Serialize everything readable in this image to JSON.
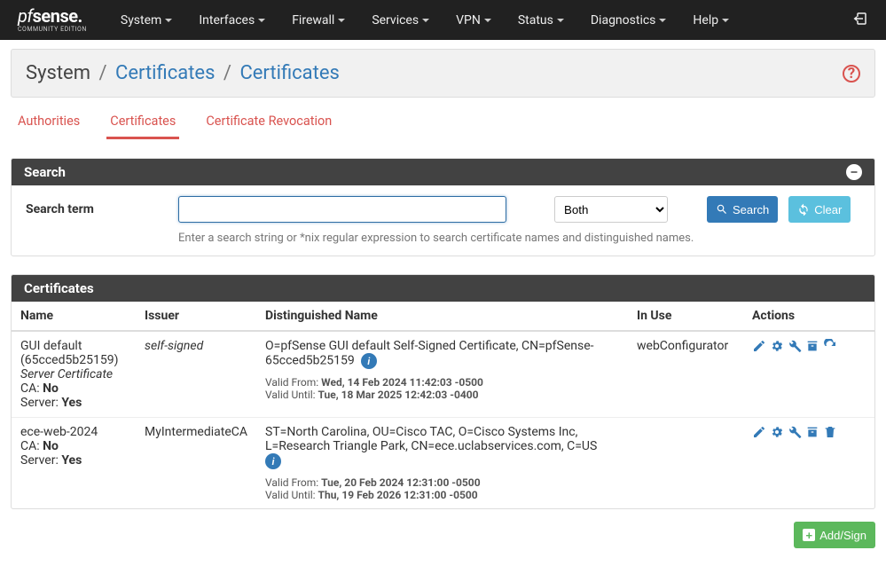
{
  "brand": {
    "top_pf": "pf",
    "top_sense": "sense",
    "top_dot": ".",
    "bottom": "COMMUNITY EDITION"
  },
  "nav": [
    "System",
    "Interfaces",
    "Firewall",
    "Services",
    "VPN",
    "Status",
    "Diagnostics",
    "Help"
  ],
  "breadcrumb": {
    "a": "System",
    "b": "Certificates",
    "c": "Certificates"
  },
  "tabs": [
    "Authorities",
    "Certificates",
    "Certificate Revocation"
  ],
  "active_tab": 1,
  "search_panel": {
    "title": "Search",
    "label": "Search term",
    "select_value": "Both",
    "search_btn": "Search",
    "clear_btn": "Clear",
    "help": "Enter a search string or *nix regular expression to search certificate names and distinguished names."
  },
  "table": {
    "title": "Certificates",
    "headers": [
      "Name",
      "Issuer",
      "Distinguished Name",
      "In Use",
      "Actions"
    ],
    "rows": [
      {
        "name": "GUI default (65cced5b25159)",
        "name_sub": "Server Certificate",
        "ca": "No",
        "server": "Yes",
        "issuer": "self-signed",
        "issuer_italic": true,
        "dn": "O=pfSense GUI default Self-Signed Certificate, CN=pfSense-65cced5b25159",
        "valid_from_lbl": "Valid From:",
        "valid_from": "Wed, 14 Feb 2024 11:42:03 -0500",
        "valid_until_lbl": "Valid Until:",
        "valid_until": "Tue, 18 Mar 2025 12:42:03 -0400",
        "in_use": "webConfigurator",
        "action_icons": [
          "pencil",
          "gear",
          "wrench",
          "archive",
          "refresh"
        ]
      },
      {
        "name": "ece-web-2024",
        "name_sub": "",
        "ca": "No",
        "server": "Yes",
        "issuer": "MyIntermediateCA",
        "issuer_italic": false,
        "dn": "ST=North Carolina, OU=Cisco TAC, O=Cisco Systems Inc, L=Research Triangle Park, CN=ece.uclabservices.com, C=US",
        "valid_from_lbl": "Valid From:",
        "valid_from": "Tue, 20 Feb 2024 12:31:00 -0500",
        "valid_until_lbl": "Valid Until:",
        "valid_until": "Thu, 19 Feb 2026 12:31:00 -0500",
        "in_use": "",
        "action_icons": [
          "pencil",
          "gear",
          "wrench",
          "archive",
          "trash"
        ]
      }
    ],
    "labels": {
      "ca": "CA:",
      "server": "Server:"
    }
  },
  "add_btn": "Add/Sign"
}
